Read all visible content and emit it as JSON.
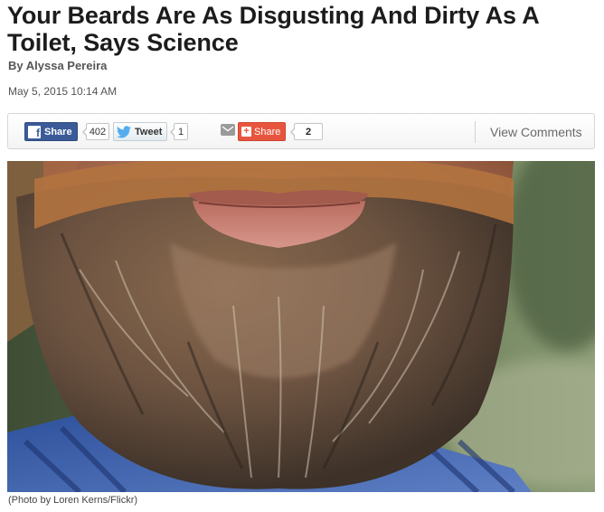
{
  "article": {
    "headline": "Your Beards Are As Disgusting And Dirty As A Toilet, Says Science",
    "byline": "By Alyssa Pereira",
    "date": "May 5, 2015 10:14 AM"
  },
  "share_bar": {
    "facebook": {
      "label": "Share",
      "icon": "facebook-icon",
      "count": "402",
      "color": "#3b5b98"
    },
    "twitter": {
      "label": "Tweet",
      "icon": "twitter-bird-icon",
      "count": "1",
      "color": "#55acee"
    },
    "email": {
      "icon": "envelope-icon"
    },
    "share": {
      "label": "Share",
      "icon": "plus-icon",
      "count": "2",
      "color": "#e8553e"
    },
    "view_comments": "View Comments"
  },
  "photo": {
    "subject": "close-up of a man's beard",
    "caption": "(Photo by Loren Kerns/Flickr)"
  }
}
